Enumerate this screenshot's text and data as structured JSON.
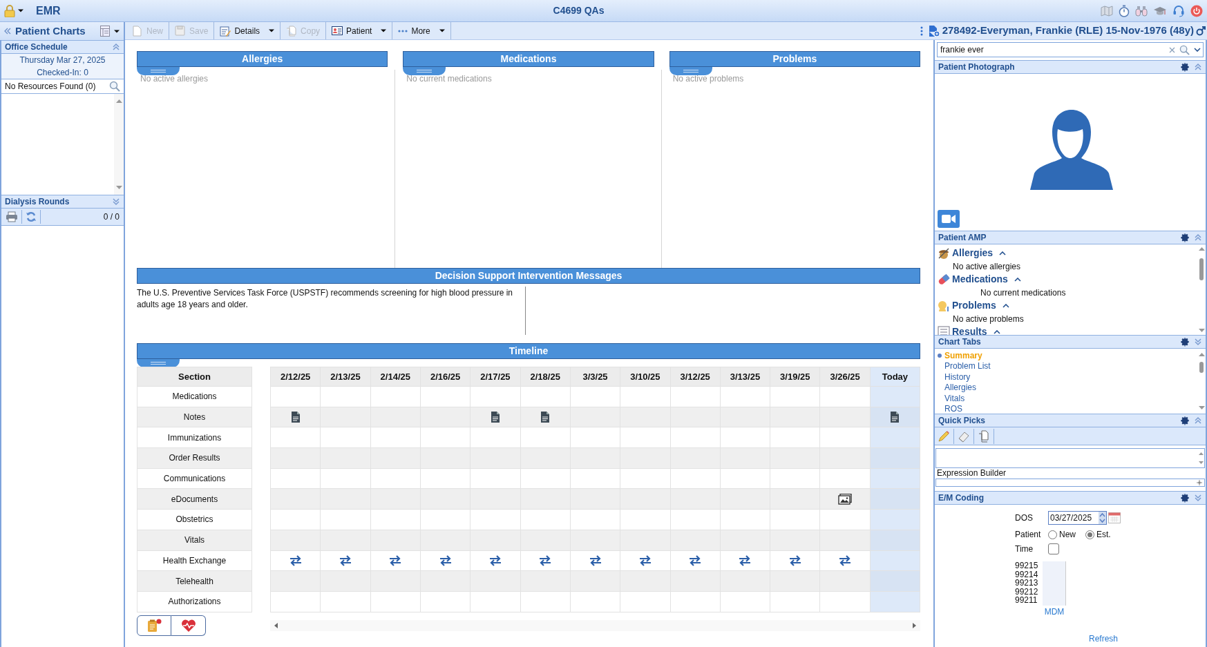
{
  "app": {
    "title": "EMR",
    "window_title": "C4699 QAs"
  },
  "left": {
    "title": "Patient Charts",
    "office_schedule": {
      "title": "Office Schedule",
      "date": "Thursday Mar 27, 2025",
      "checked_in": "Checked-In: 0",
      "resources": "No Resources Found (0)"
    },
    "dialysis": {
      "title": "Dialysis Rounds",
      "count": "0 / 0"
    }
  },
  "toolbar": [
    {
      "label": "New",
      "disabled": true,
      "dropdown": false
    },
    {
      "label": "Save",
      "disabled": true,
      "dropdown": false
    },
    {
      "label": "Details",
      "disabled": false,
      "dropdown": true
    },
    {
      "label": "Copy",
      "disabled": true,
      "dropdown": false
    },
    {
      "label": "Patient",
      "disabled": false,
      "dropdown": true
    },
    {
      "label": "More",
      "disabled": false,
      "dropdown": true
    }
  ],
  "patient_banner": "278492-Everyman, Frankie (RLE) 15-Nov-1976 (48y)",
  "summary_panels": [
    {
      "title": "Allergies",
      "empty": "No active allergies"
    },
    {
      "title": "Medications",
      "empty": "No current medications"
    },
    {
      "title": "Problems",
      "empty": "No active problems"
    }
  ],
  "dsi": {
    "title": "Decision Support Intervention Messages",
    "message": "The U.S. Preventive Services Task Force (USPSTF) recommends screening for high blood pressure in adults age 18 years and older."
  },
  "timeline": {
    "title": "Timeline",
    "section_header": "Section",
    "dates": [
      {
        "label": "2/12/25",
        "today": false
      },
      {
        "label": "2/13/25",
        "today": false
      },
      {
        "label": "2/14/25",
        "today": false
      },
      {
        "label": "2/16/25",
        "today": false
      },
      {
        "label": "2/17/25",
        "today": false
      },
      {
        "label": "2/18/25",
        "today": false
      },
      {
        "label": "3/3/25",
        "today": false
      },
      {
        "label": "3/10/25",
        "today": false
      },
      {
        "label": "3/12/25",
        "today": false
      },
      {
        "label": "3/13/25",
        "today": false
      },
      {
        "label": "3/19/25",
        "today": false
      },
      {
        "label": "3/26/25",
        "today": false
      },
      {
        "label": "Today",
        "today": true
      }
    ],
    "rows": [
      {
        "section": "Medications",
        "cells": [
          null,
          null,
          null,
          null,
          null,
          null,
          null,
          null,
          null,
          null,
          null,
          null,
          null
        ]
      },
      {
        "section": "Notes",
        "cells": [
          {
            "kind": "note"
          },
          null,
          null,
          null,
          {
            "kind": "note"
          },
          {
            "kind": "note"
          },
          null,
          null,
          null,
          null,
          null,
          null,
          {
            "kind": "note"
          }
        ]
      },
      {
        "section": "Immunizations",
        "cells": [
          null,
          null,
          null,
          null,
          null,
          null,
          null,
          null,
          null,
          null,
          null,
          null,
          null
        ]
      },
      {
        "section": "Order Results",
        "cells": [
          null,
          null,
          null,
          null,
          null,
          null,
          null,
          null,
          null,
          null,
          null,
          null,
          null
        ]
      },
      {
        "section": "Communications",
        "cells": [
          null,
          null,
          null,
          null,
          null,
          null,
          null,
          null,
          null,
          null,
          null,
          null,
          null
        ]
      },
      {
        "section": "eDocuments",
        "cells": [
          null,
          null,
          null,
          null,
          null,
          null,
          null,
          null,
          null,
          null,
          null,
          {
            "kind": "image"
          },
          null
        ]
      },
      {
        "section": "Obstetrics",
        "cells": [
          null,
          null,
          null,
          null,
          null,
          null,
          null,
          null,
          null,
          null,
          null,
          null,
          null
        ]
      },
      {
        "section": "Vitals",
        "cells": [
          null,
          null,
          null,
          null,
          null,
          null,
          null,
          null,
          null,
          null,
          null,
          null,
          null
        ]
      },
      {
        "section": "Health Exchange",
        "cells": [
          {
            "kind": "exchange"
          },
          {
            "kind": "exchange"
          },
          {
            "kind": "exchange"
          },
          {
            "kind": "exchange"
          },
          {
            "kind": "exchange"
          },
          {
            "kind": "exchange"
          },
          {
            "kind": "exchange"
          },
          {
            "kind": "exchange"
          },
          {
            "kind": "exchange"
          },
          {
            "kind": "exchange"
          },
          {
            "kind": "exchange"
          },
          {
            "kind": "exchange"
          },
          null
        ]
      },
      {
        "section": "Telehealth",
        "cells": [
          null,
          null,
          null,
          null,
          null,
          null,
          null,
          null,
          null,
          null,
          null,
          null,
          null
        ]
      },
      {
        "section": "Authorizations",
        "cells": [
          null,
          null,
          null,
          null,
          null,
          null,
          null,
          null,
          null,
          null,
          null,
          null,
          null
        ]
      }
    ]
  },
  "right": {
    "search": {
      "value": "frankie ever"
    },
    "photo_title": "Patient Photograph",
    "amp": {
      "title": "Patient AMP",
      "items": [
        {
          "title": "Allergies",
          "text": "No active allergies"
        },
        {
          "title": "Medications",
          "text": "No current medications"
        },
        {
          "title": "Problems",
          "text": "No active problems"
        },
        {
          "title": "Results"
        }
      ]
    },
    "chart_tabs": {
      "title": "Chart Tabs",
      "items": [
        {
          "label": "Summary",
          "selected": true
        },
        {
          "label": "Problem List",
          "selected": false
        },
        {
          "label": "History",
          "selected": false
        },
        {
          "label": "Allergies",
          "selected": false
        },
        {
          "label": "Vitals",
          "selected": false
        },
        {
          "label": "ROS",
          "selected": false
        }
      ]
    },
    "quick_picks": {
      "title": "Quick Picks",
      "expression_label": "Expression Builder"
    },
    "em": {
      "title": "E/M Coding",
      "dos_label": "DOS",
      "dos": "03/27/2025",
      "patient_label": "Patient",
      "patient_options": [
        {
          "label": "New",
          "selected": false
        },
        {
          "label": "Est.",
          "selected": true
        }
      ],
      "time_label": "Time",
      "time_checked": false,
      "codes": [
        "99215",
        "99214",
        "99213",
        "99212",
        "99211"
      ],
      "mdm": "MDM",
      "refresh": "Refresh"
    }
  }
}
